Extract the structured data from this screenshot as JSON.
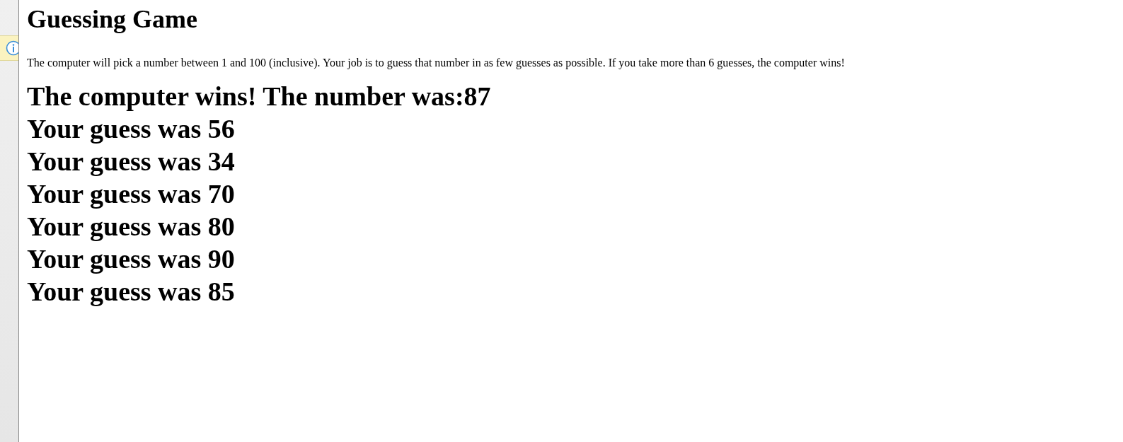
{
  "title": "Guessing Game",
  "description": "The computer will pick a number between 1 and 100 (inclusive). Your job is to guess that number in as few guesses as possible. If you take more than 6 guesses, the computer wins!",
  "result": "The computer wins! The number was:87",
  "guesses": [
    "Your guess was 56",
    "Your guess was 34",
    "Your guess was 70",
    "Your guess was 80",
    "Your guess was 90",
    "Your guess was 85"
  ]
}
